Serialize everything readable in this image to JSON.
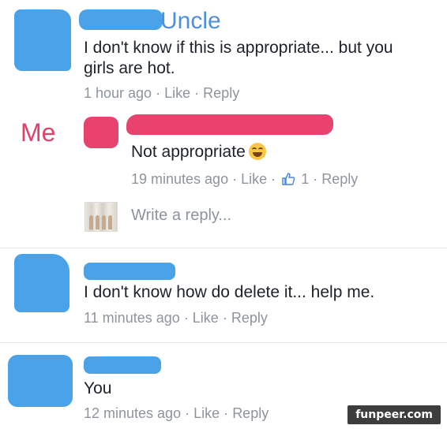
{
  "comments": [
    {
      "name_overlay": "Uncle",
      "text_line1": "I don't know if this is appropriate... but you",
      "text_line2": "girls are hot.",
      "time": "1 hour ago",
      "like": "Like",
      "reply": "Reply"
    },
    {
      "name_overlay": "Me",
      "text": "Not appropriate",
      "time": "19 minutes ago",
      "like": "Like",
      "like_count": "1",
      "reply": "Reply"
    },
    {
      "text": "I don't know how do delete it... help me.",
      "time": "11 minutes ago",
      "like": "Like",
      "reply": "Reply"
    },
    {
      "text": "You",
      "time": "12 minutes ago",
      "like": "Like",
      "reply": "Reply"
    }
  ],
  "write_reply_placeholder": "Write a reply...",
  "separator": "·",
  "watermark": "funpeer.com",
  "colors": {
    "redaction_blue": "#4aa3e8",
    "redaction_pink": "#e8436f",
    "meta_gray": "#8d949e"
  },
  "icons": [
    "laughing-emoji-icon",
    "thumbs-up-icon",
    "photo-avatar"
  ]
}
